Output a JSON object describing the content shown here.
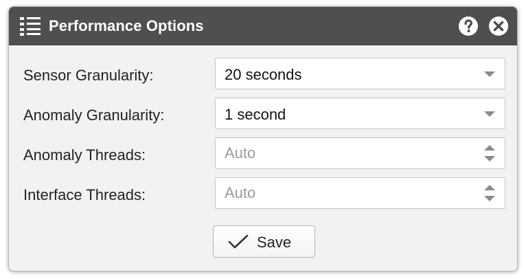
{
  "window": {
    "title": "Performance Options",
    "title_icon": "list-icon",
    "help_icon": "help-icon",
    "close_icon": "close-icon"
  },
  "form": {
    "sensor_granularity": {
      "label": "Sensor Granularity:",
      "value": "20 seconds"
    },
    "anomaly_granularity": {
      "label": "Anomaly Granularity:",
      "value": "1 second"
    },
    "anomaly_threads": {
      "label": "Anomaly Threads:",
      "value": "",
      "placeholder": "Auto"
    },
    "interface_threads": {
      "label": "Interface Threads:",
      "value": "",
      "placeholder": "Auto"
    }
  },
  "footer": {
    "save_label": "Save",
    "save_icon": "checkmark-icon"
  },
  "colors": {
    "titlebar": "#4f4f4f",
    "dialog_background": "#f2f2f2",
    "field_border": "#c4c4c4"
  }
}
